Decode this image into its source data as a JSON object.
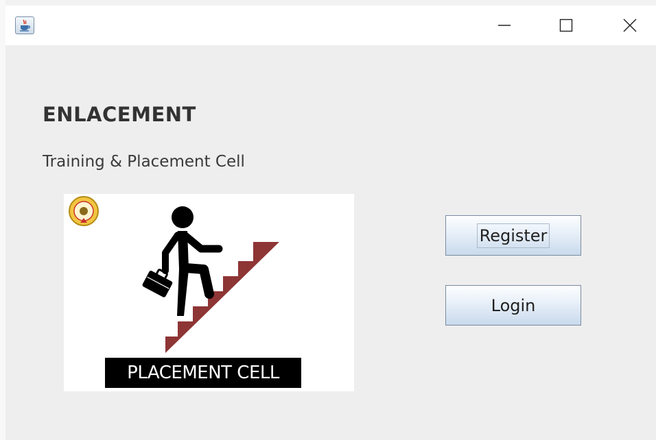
{
  "window": {
    "controls": {
      "minimize_icon": "minimize-icon",
      "maximize_icon": "maximize-icon",
      "close_icon": "close-icon"
    },
    "app_icon": "java-coffee-icon"
  },
  "header": {
    "title": "ENLACEMENT",
    "subtitle": "Training & Placement Cell"
  },
  "banner": {
    "caption": "PLACEMENT CELL",
    "colors": {
      "stairs": "#8e3535",
      "figure": "#000000",
      "caption_bg": "#000000",
      "caption_text": "#ffffff"
    }
  },
  "actions": {
    "register_label": "Register",
    "login_label": "Login",
    "focused": "register"
  }
}
